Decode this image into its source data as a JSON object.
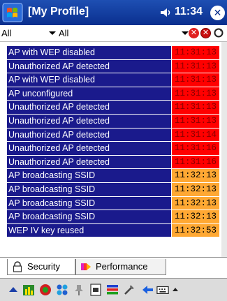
{
  "title_bar": {
    "title": "[My Profile]",
    "clock": "11:34",
    "close_label": "✕"
  },
  "filters": {
    "left_value": "All",
    "right_value": "All"
  },
  "colors": {
    "message_bg": "#1a1a8c",
    "critical_bg": "#ff0000",
    "critical_text": "#8a0000",
    "warning_bg": "#ffa833",
    "warning_text": "#000000",
    "title_bg": "#0a2f8e"
  },
  "alerts": [
    {
      "message": "AP with WEP disabled",
      "time": "11:31:13",
      "severity": "critical"
    },
    {
      "message": "Unauthorized AP detected",
      "time": "11:31:13",
      "severity": "critical"
    },
    {
      "message": "AP with WEP disabled",
      "time": "11:31:13",
      "severity": "critical"
    },
    {
      "message": "AP unconfigured",
      "time": "11:31:13",
      "severity": "critical"
    },
    {
      "message": "Unauthorized AP detected",
      "time": "11:31:13",
      "severity": "critical"
    },
    {
      "message": "Unauthorized AP detected",
      "time": "11:31:13",
      "severity": "critical"
    },
    {
      "message": "Unauthorized AP detected",
      "time": "11:31:14",
      "severity": "critical"
    },
    {
      "message": "Unauthorized AP detected",
      "time": "11:31:16",
      "severity": "critical"
    },
    {
      "message": "Unauthorized AP detected",
      "time": "11:31:16",
      "severity": "critical"
    },
    {
      "message": "AP broadcasting SSID",
      "time": "11:32:13",
      "severity": "warning"
    },
    {
      "message": "AP broadcasting SSID",
      "time": "11:32:13",
      "severity": "warning"
    },
    {
      "message": "AP broadcasting SSID",
      "time": "11:32:13",
      "severity": "warning"
    },
    {
      "message": "AP broadcasting SSID",
      "time": "11:32:13",
      "severity": "warning"
    },
    {
      "message": "WEP IV key reused",
      "time": "11:32:53",
      "severity": "warning"
    }
  ],
  "tabs": {
    "security": "Security",
    "performance": "Performance"
  },
  "taskbar_icons": [
    "up-arrow-icon",
    "bar-chart-icon",
    "signal-icon",
    "network-icon",
    "pin-icon",
    "notepad-icon",
    "color-bars-icon",
    "tools-icon",
    "back-arrow-icon",
    "keyboard-icon",
    "input-menu-icon"
  ]
}
